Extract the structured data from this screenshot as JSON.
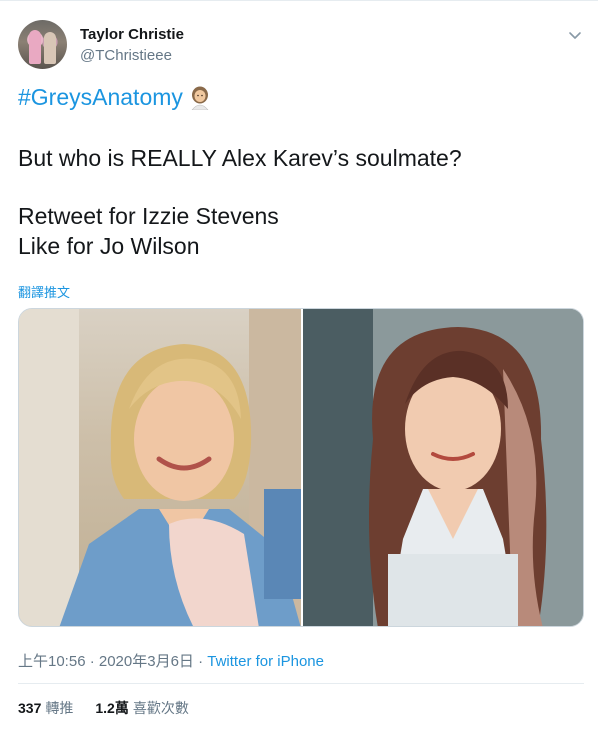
{
  "tweet": {
    "display_name": "Taylor Christie",
    "handle": "@TChristieee",
    "hashtag": "#GreysAnatomy",
    "line1": "But who is REALLY Alex Karev’s soulmate?",
    "line2": "Retweet for Izzie Stevens",
    "line3": "Like for Jo Wilson",
    "translate_label": "翻譯推文",
    "time": "上午10:56 · 2020年3月6日 · ",
    "source": "Twitter for iPhone",
    "retweets_count": "337",
    "retweets_label": "轉推",
    "likes_count": "1.2萬",
    "likes_label": "喜歡次數"
  },
  "icons": {
    "caret": "chevron-down-icon",
    "emoji": "woman-health-worker-emoji"
  },
  "colors": {
    "link": "#1b95e0",
    "text": "#14171a",
    "secondary": "#657786"
  }
}
